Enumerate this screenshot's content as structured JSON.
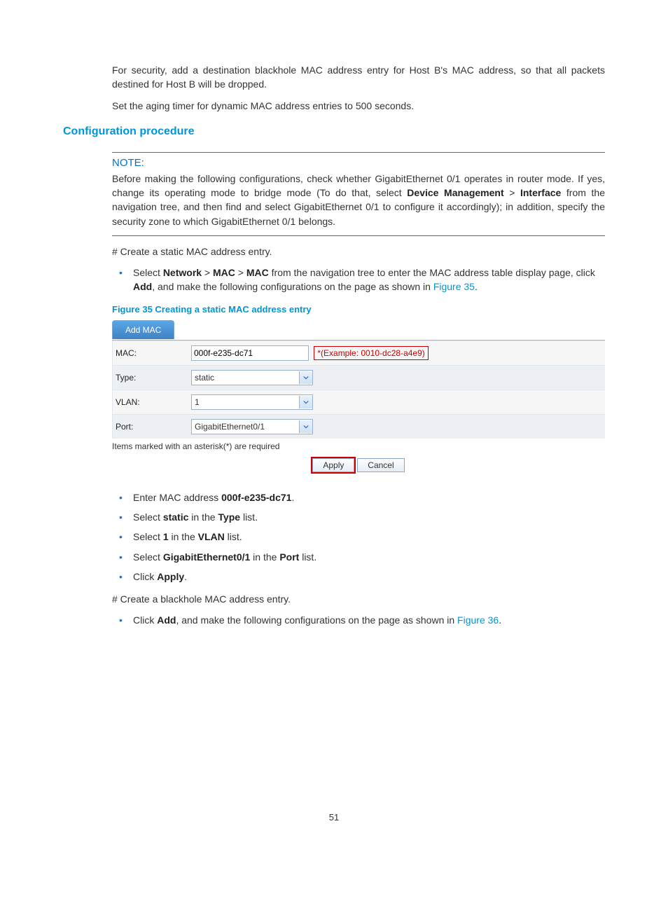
{
  "intro": {
    "p1_a": "For security, add a destination blackhole MAC address entry for Host B's MAC address, so that all packets destined for Host B will be dropped.",
    "p2": "Set the aging timer for dynamic MAC address entries to 500 seconds."
  },
  "section_title": "Configuration procedure",
  "note": {
    "title": "NOTE:",
    "body_prefix": "Before making the following configurations, check whether GigabitEthernet 0/1 operates in router mode. If yes, change its operating mode to bridge mode (To do that, select ",
    "bold1": "Device Management",
    "gt": " > ",
    "bold2": "Interface",
    "body_suffix": " from the navigation tree, and then find and select GigabitEthernet 0/1 to configure it accordingly); in addition, specify the security zone to which GigabitEthernet 0/1 belongs."
  },
  "step1": "# Create a static MAC address entry.",
  "bullet1": {
    "a": "Select ",
    "b1": "Network",
    "g1": " > ",
    "b2": "MAC",
    "g2": " > ",
    "b3": "MAC",
    "c": " from the navigation tree to enter the MAC address table display page, click ",
    "b4": "Add",
    "d": ", and make the following configurations on the page as shown in ",
    "link": "Figure 35",
    "e": "."
  },
  "fig35_caption": "Figure 35 Creating a static MAC address entry",
  "form": {
    "tab": "Add MAC",
    "mac_label": "MAC:",
    "mac_value": "000f-e235-dc71",
    "mac_example": "*(Example: 0010-dc28-a4e9)",
    "type_label": "Type:",
    "type_value": "static",
    "vlan_label": "VLAN:",
    "vlan_value": "1",
    "port_label": "Port:",
    "port_value": "GigabitEthernet0/1",
    "req_note": "Items marked with an asterisk(*) are required",
    "apply": "Apply",
    "cancel": "Cancel"
  },
  "bullets2": {
    "i1a": "Enter MAC address ",
    "i1b": "000f-e235-dc71",
    "i1c": ".",
    "i2a": "Select ",
    "i2b": "static",
    "i2c": " in the ",
    "i2d": "Type",
    "i2e": " list.",
    "i3a": "Select ",
    "i3b": "1",
    "i3c": " in the ",
    "i3d": "VLAN",
    "i3e": " list.",
    "i4a": "Select ",
    "i4b": "GigabitEthernet0/1",
    "i4c": " in the ",
    "i4d": "Port",
    "i4e": " list.",
    "i5a": "Click ",
    "i5b": "Apply",
    "i5c": "."
  },
  "step2": "# Create a blackhole MAC address entry.",
  "bullet3": {
    "a": "Click ",
    "b": "Add",
    "c": ", and make the following configurations on the page as shown in ",
    "link": "Figure 36",
    "d": "."
  },
  "page_number": "51"
}
